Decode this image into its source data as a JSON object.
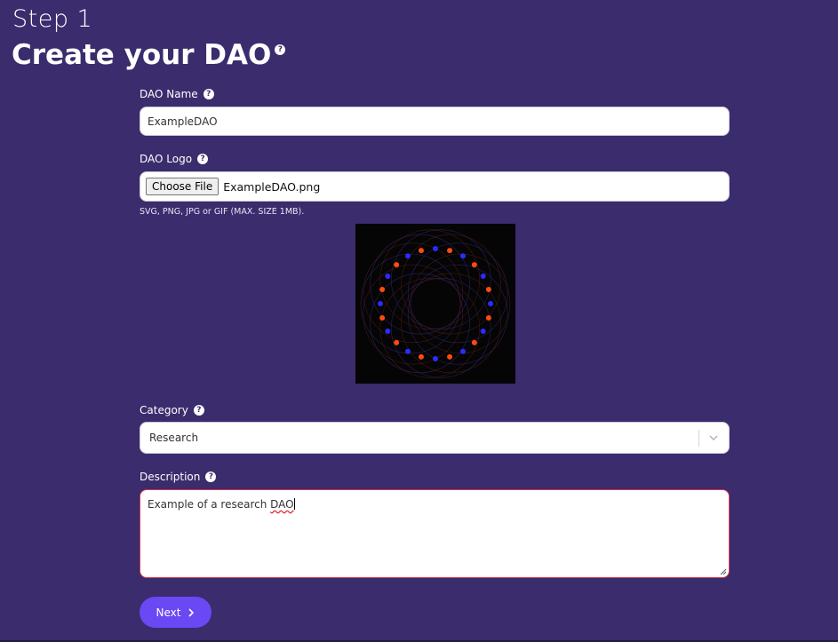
{
  "header": {
    "step": "Step 1",
    "title": "Create your DAO",
    "help_glyph": "?"
  },
  "form": {
    "name": {
      "label": "DAO Name",
      "value": "ExampleDAO"
    },
    "logo": {
      "label": "DAO Logo",
      "button_label": "Choose File",
      "file_name": "ExampleDAO.png",
      "hint": "SVG, PNG, JPG or GIF (MAX. SIZE 1MB)."
    },
    "category": {
      "label": "Category",
      "selected": "Research",
      "icon": "chevron-down-icon"
    },
    "description": {
      "label": "Description",
      "value_prefix": "Example of a research ",
      "value_flagged": "DAO"
    },
    "next_label": "Next"
  },
  "colors": {
    "background": "#3a2c6d",
    "button": "#6a48f3",
    "error_border": "#d53b53"
  }
}
